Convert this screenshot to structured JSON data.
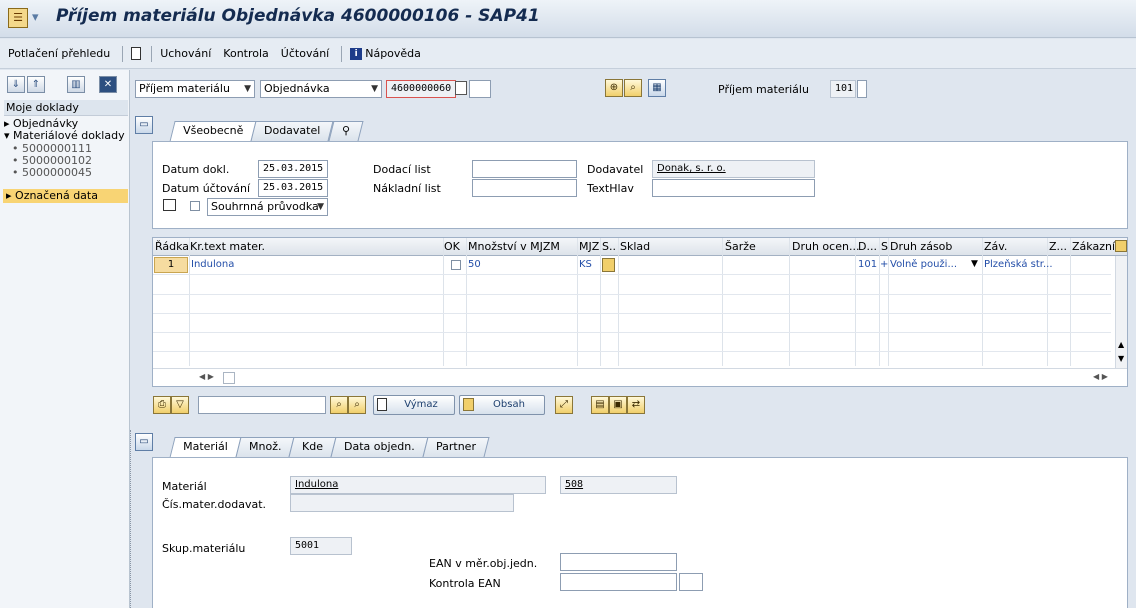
{
  "window": {
    "title": "Příjem materiálu Objednávka 4600000106 - SAP41"
  },
  "menu": {
    "items": [
      "Potlačení přehledu",
      "Uchování",
      "Kontrola",
      "Účtování",
      "Nápověda"
    ]
  },
  "left_panel": {
    "header": "Moje doklady",
    "tree": [
      {
        "label": "Objednávky",
        "marker": "▸"
      },
      {
        "label": "Materiálové doklady",
        "marker": "▾"
      }
    ],
    "docs": [
      "5000000111",
      "5000000102",
      "5000000045"
    ],
    "selected": "Označená data",
    "selected_marker": "▸"
  },
  "top_row": {
    "action": "Příjem materiálu",
    "ref_type": "Objednávka",
    "po_number": "4600000060",
    "movement_label": "Příjem materiálu",
    "movement_type": "101"
  },
  "header_tabs": [
    "Všeobecně",
    "Dodavatel",
    "⚲"
  ],
  "header_fields": {
    "datum_dokl_label": "Datum dokl.",
    "datum_dokl": "25.03.2015",
    "datum_uct_label": "Datum účtování",
    "datum_uct": "25.03.2015",
    "dodaci_list_label": "Dodací list",
    "dodaci_list": "",
    "nakladni_list_label": "Nákladní list",
    "nakladni_list": "",
    "dodavatel_label": "Dodavatel",
    "dodavatel": "Donak, s. r. o.",
    "texthlav_label": "TextHlav",
    "texthlav": "",
    "print_option": "Souhrnná průvodka"
  },
  "grid": {
    "headers": [
      "Řádka",
      "Kr.text mater.",
      "OK",
      "Množství v MJZM",
      "MJZ",
      "S..",
      "Sklad",
      "Šarže",
      "Druh ocen...",
      "D...",
      "S",
      "Druh zásob",
      "Záv.",
      "Z...",
      "Zákazník"
    ],
    "rows": [
      {
        "radka": "1",
        "text": "Indulona",
        "mnozstvi": "50",
        "mjz": "KS",
        "d": "101",
        "s": "+",
        "druh_zasob": "Volně použi...",
        "zav": "Plzeňská str..."
      }
    ]
  },
  "toolbar": {
    "delete_label": "Výmaz",
    "content_label": "Obsah",
    "search_value": ""
  },
  "item_tabs": [
    "Materiál",
    "Množ.",
    "Kde",
    "Data objedn.",
    "Partner"
  ],
  "item_fields": {
    "material_label": "Materiál",
    "material": "Indulona",
    "material_code": "508",
    "cis_label": "Čís.mater.dodavat.",
    "cis": "",
    "skup_label": "Skup.materiálu",
    "skup": "5001",
    "ean_label": "EAN v měr.obj.jedn.",
    "ean": "",
    "kontrola_label": "Kontrola EAN",
    "kontrola": ""
  }
}
